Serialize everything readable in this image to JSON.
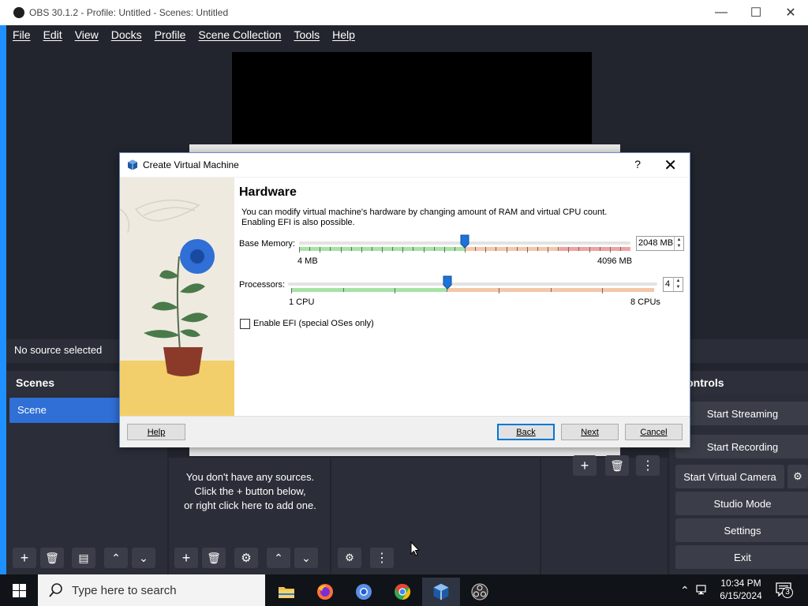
{
  "obs": {
    "title": "OBS 30.1.2 - Profile: Untitled - Scenes: Untitled",
    "menu": [
      "File",
      "Edit",
      "View",
      "Docks",
      "Profile",
      "Scene Collection",
      "Tools",
      "Help"
    ],
    "no_source": "No source selected",
    "scenes_title": "Scenes",
    "scene_item": "Scene",
    "sources_empty": [
      "You don't have any sources.",
      "Click the + button below,",
      "or right click here to add one."
    ],
    "controls_title": "Controls",
    "controls": [
      "Start Streaming",
      "Start Recording",
      "Start Virtual Camera",
      "Studio Mode",
      "Settings",
      "Exit"
    ]
  },
  "dialog": {
    "title": "Create Virtual Machine",
    "help_glyph": "?",
    "heading": "Hardware",
    "description": "You can modify virtual machine's hardware by changing amount of RAM and virtual CPU count.\nEnabling EFI is also possible.",
    "memory": {
      "label": "Base Memory:",
      "value": "2048 MB",
      "min_label": "4 MB",
      "max_label": "4096 MB",
      "value_fraction": 0.5
    },
    "processors": {
      "label": "Processors:",
      "value": "4",
      "min_label": "1 CPU",
      "max_label": "8 CPUs",
      "value_fraction": 0.43
    },
    "efi": {
      "label": "Enable EFI (special OSes only)",
      "checked": false
    },
    "buttons": {
      "help": "Help",
      "back": "Back",
      "next": "Next",
      "cancel": "Cancel"
    }
  },
  "taskbar": {
    "search_placeholder": "Type here to search",
    "apps": [
      "file-explorer",
      "firefox",
      "chromium",
      "chrome",
      "virtualbox",
      "obs"
    ],
    "time": "10:34 PM",
    "date": "6/15/2024",
    "notification_count": "3"
  },
  "colors": {
    "obs_bg": "#22252d",
    "obs_dock": "#2b2e38",
    "accent_blue": "#2f6fd6",
    "dialog_bg": "#f0f0f0"
  }
}
